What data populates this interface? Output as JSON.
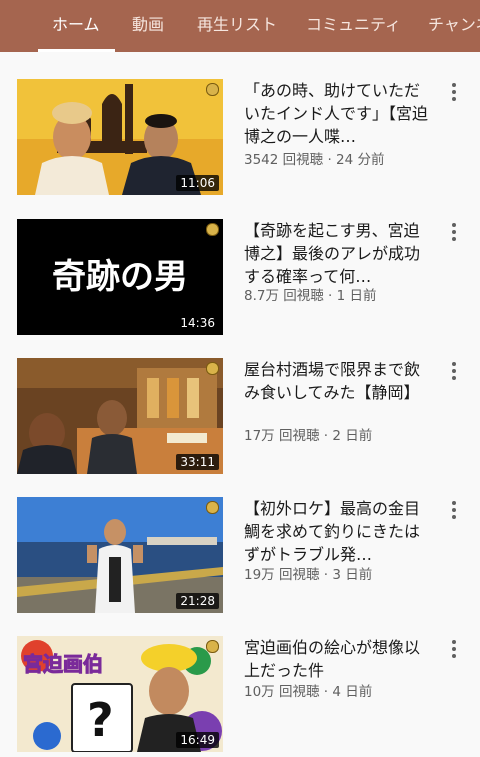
{
  "tabs": [
    {
      "label": "ホーム",
      "active": true
    },
    {
      "label": "動画"
    },
    {
      "label": "再生リスト"
    },
    {
      "label": "コミュニティ"
    },
    {
      "label": "チャンネ"
    }
  ],
  "colors": {
    "tab_bar": "#a5654f",
    "background": "#f9f9f9",
    "meta_text": "#606060"
  },
  "videos": [
    {
      "title": "「あの時、助けていただいたインド人です」【宮迫博之の一人喋…",
      "meta": "3542 回視聴 · 24 分前",
      "duration": "11:06"
    },
    {
      "title": "【奇跡を起こす男、宮迫博之】最後のアレが成功する確率って何…",
      "meta": "8.7万 回視聴 · 1 日前",
      "duration": "14:36",
      "thumb_text": "奇跡の男"
    },
    {
      "title": "屋台村酒場で限界まで飲み食いしてみた【静岡】",
      "meta": "17万 回視聴 · 2 日前",
      "duration": "33:11"
    },
    {
      "title": "【初外ロケ】最高の金目鯛を求めて釣りにきたはずがトラブル発…",
      "meta": "19万 回視聴 · 3 日前",
      "duration": "21:28"
    },
    {
      "title": "宮迫画伯の絵心が想像以上だった件",
      "meta": "10万 回視聴 · 4 日前",
      "duration": "16:49",
      "thumb_text": "宮迫画伯"
    }
  ]
}
